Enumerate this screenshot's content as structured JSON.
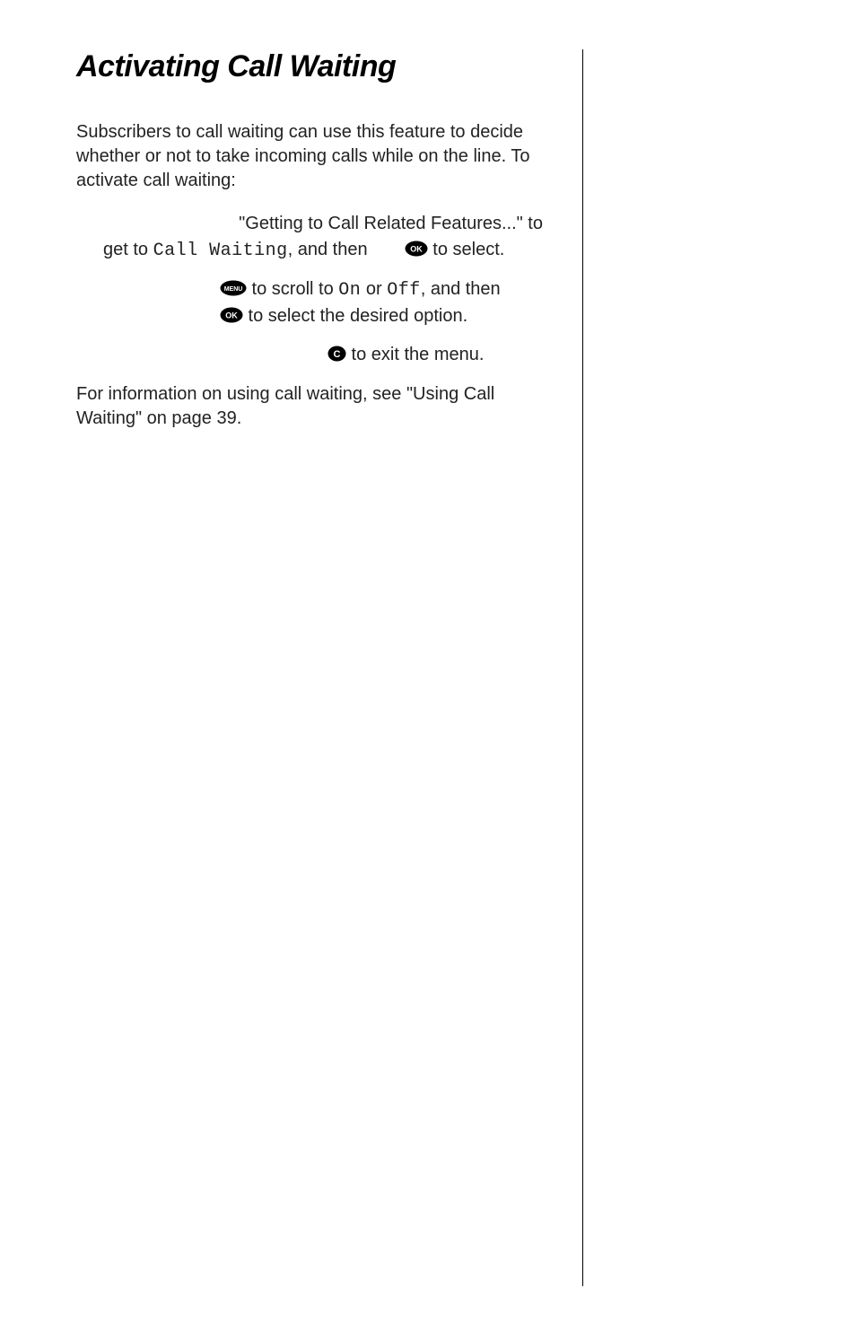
{
  "title": "Activating Call Waiting",
  "intro": "Subscribers to call waiting can use this feature to decide whether or not to take incoming calls while on the line. To activate call waiting:",
  "step1_a": "\"Getting to Call Related Features...\" to get to ",
  "step1_menu": "Call Waiting",
  "step1_b": ", and then ",
  "step1_c": " to select.",
  "step2_a": " to scroll to ",
  "step2_on": "On",
  "step2_or": " or ",
  "step2_off": "Off",
  "step2_b": ", and then ",
  "step2_c": " to select the desired option.",
  "step3_a": " to exit the menu.",
  "outro": "For information on using call waiting, see \"Using Call Waiting\" on page 39.",
  "icons": {
    "ok_label": "OK",
    "menu_label": "MENU",
    "c_label": "C"
  }
}
